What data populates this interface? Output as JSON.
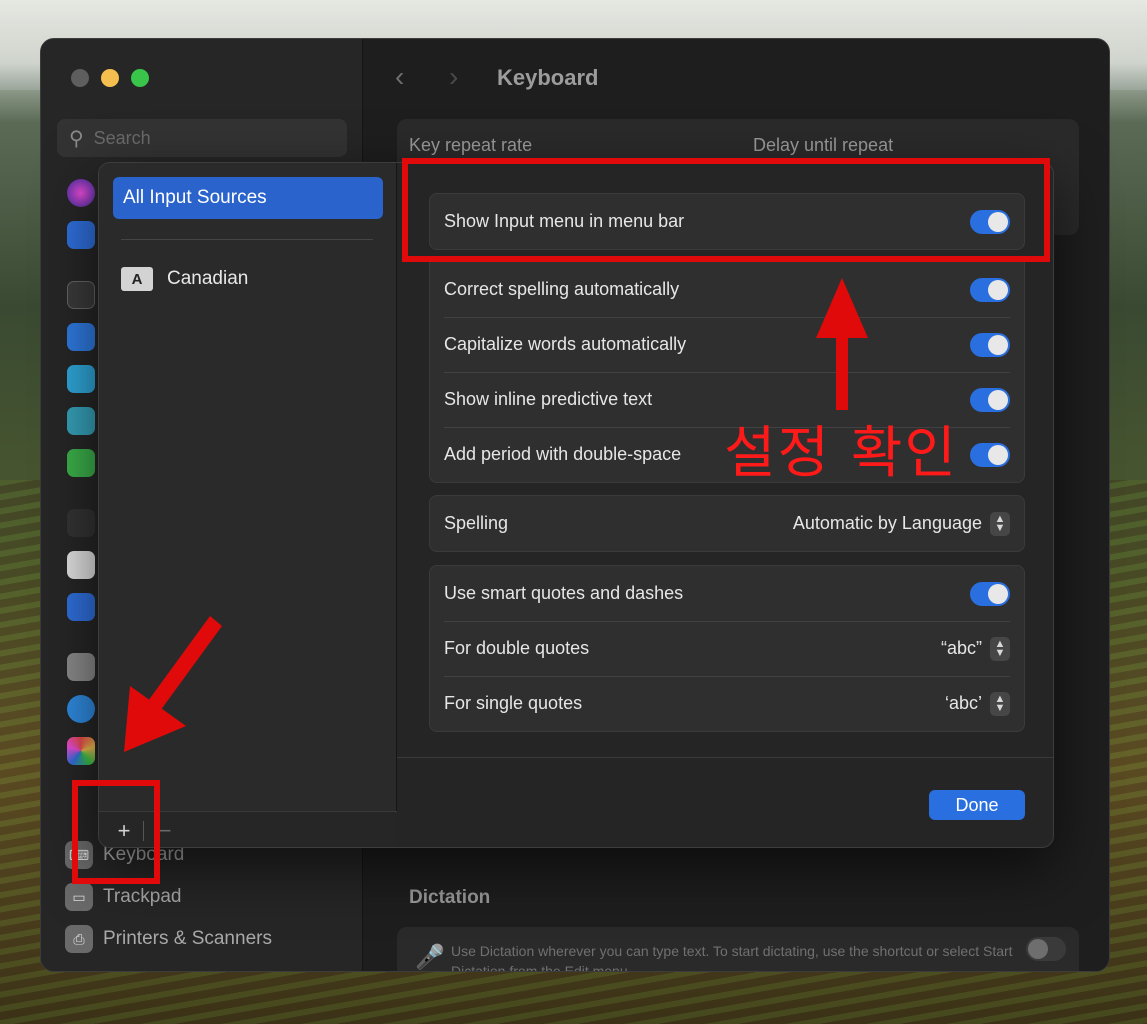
{
  "window": {
    "title": "Keyboard",
    "search_placeholder": "Search"
  },
  "sidebar": {
    "items": [
      {
        "label": "Keyboard",
        "icon": "keyboard-icon"
      },
      {
        "label": "Trackpad",
        "icon": "trackpad-icon"
      },
      {
        "label": "Printers & Scanners",
        "icon": "printer-icon"
      }
    ]
  },
  "background": {
    "key_repeat_rate": "Key repeat rate",
    "delay_until_repeat": "Delay until repeat",
    "dictation_title": "Dictation",
    "dictation_text": "Use Dictation wherever you can type text. To start dictating, use the shortcut or select Start Dictation from the Edit menu."
  },
  "sheet": {
    "sources_header": "All Input Sources",
    "sources": [
      {
        "badge": "A",
        "label": "Canadian"
      }
    ],
    "plus_label": "+",
    "minus_label": "−",
    "groups": {
      "input_menu": [
        {
          "label": "Show Input menu in menu bar",
          "on": true
        }
      ],
      "auto": [
        {
          "label": "Correct spelling automatically",
          "on": true
        },
        {
          "label": "Capitalize words automatically",
          "on": true
        },
        {
          "label": "Show inline predictive text",
          "on": true
        },
        {
          "label": "Add period with double-space",
          "on": true
        }
      ],
      "spelling": {
        "label": "Spelling",
        "value": "Automatic by Language"
      },
      "quotes": {
        "smart_label": "Use smart quotes and dashes",
        "smart_on": true,
        "double_label": "For double quotes",
        "double_value": "“abc”",
        "single_label": "For single quotes",
        "single_value": "‘abc’"
      }
    },
    "done_label": "Done"
  },
  "annotation": {
    "text": "설정 확인",
    "color": "#e00a0a"
  }
}
